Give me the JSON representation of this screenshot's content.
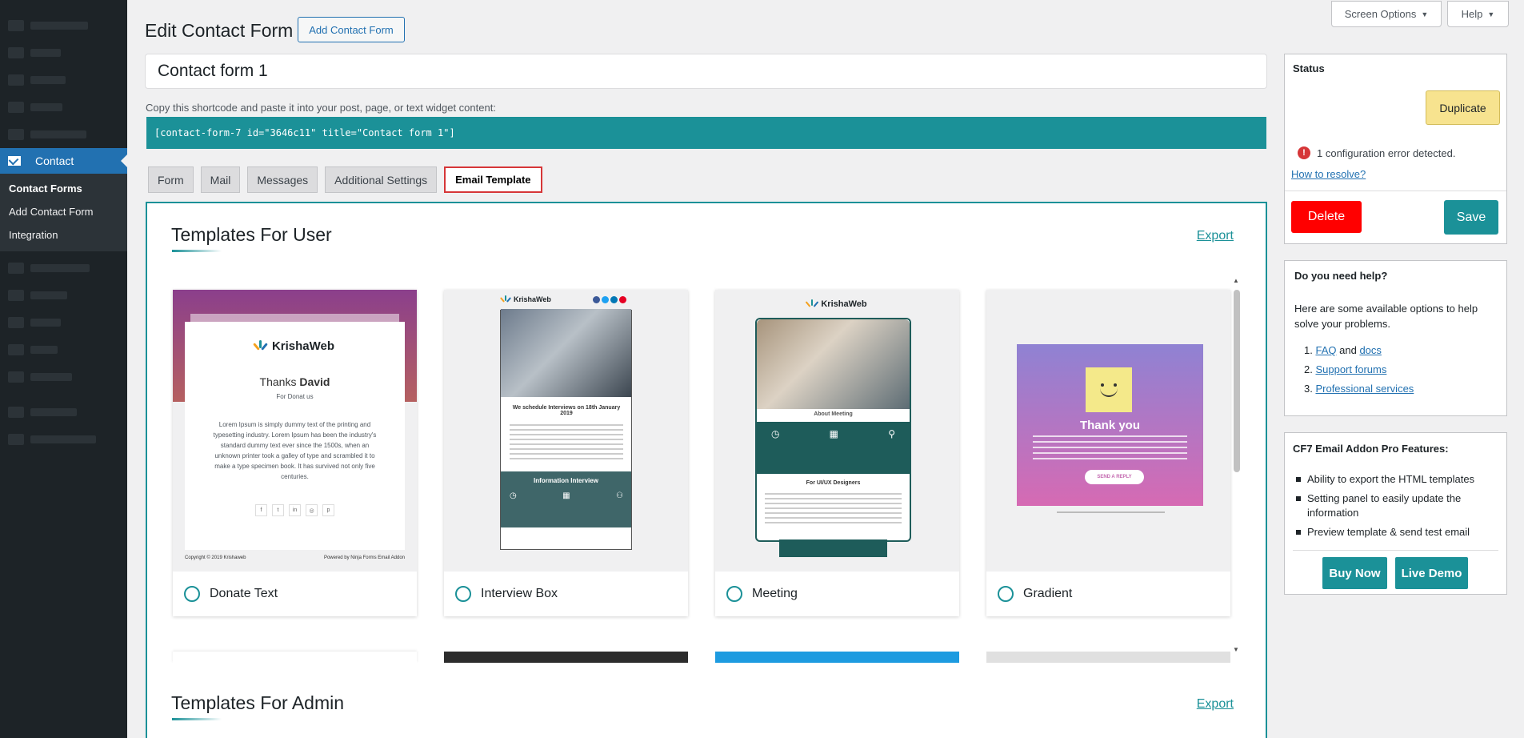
{
  "sidebar": {
    "current": "Contact",
    "submenu": [
      "Contact Forms",
      "Add Contact Form",
      "Integration"
    ]
  },
  "screen_options": "Screen Options",
  "help": "Help",
  "header": {
    "title": "Edit Contact Form",
    "add_button": "Add Contact Form"
  },
  "form_title": "Contact form 1",
  "shortcode": {
    "label": "Copy this shortcode and paste it into your post, page, or text widget content:",
    "code": "[contact-form-7 id=\"3646c11\" title=\"Contact form 1\"]"
  },
  "tabs": [
    "Form",
    "Mail",
    "Messages",
    "Additional Settings",
    "Email Template"
  ],
  "templates_user": {
    "title": "Templates For User",
    "export": "Export",
    "cards": [
      "Donate Text",
      "Interview Box",
      "Meeting",
      "Gradient"
    ]
  },
  "templates_admin": {
    "title": "Templates For Admin",
    "export": "Export"
  },
  "previews": {
    "logo": "KrishaWeb",
    "donate": {
      "thanks": "Thanks",
      "name": "David",
      "sub": "For Donat us",
      "body": "Lorem Ipsum is simply dummy text of the printing and typesetting industry. Lorem Ipsum has been the industry's standard dummy text ever since the 1500s, when an unknown printer took a galley of type and scrambled it to make a type specimen book. It has survived not only five centuries.",
      "copyright": "Copyright © 2019 Krishaweb",
      "powered": "Powered by Ninja Forms Email Addon"
    },
    "interview": {
      "heading": "We schedule Interviews on 18th January 2019",
      "box_title": "Information Interview"
    },
    "meeting": {
      "about": "About Meeting",
      "designers": "For UI/UX Designers"
    },
    "gradient": {
      "thanks": "Thank you",
      "button": "SEND A REPLY"
    }
  },
  "status_box": {
    "title": "Status",
    "duplicate": "Duplicate",
    "error": "1 configuration error detected.",
    "resolve_link": "How to resolve?",
    "delete": "Delete",
    "save": "Save"
  },
  "help_box": {
    "title": "Do you need help?",
    "intro": "Here are some available options to help solve your problems.",
    "item1_num": "1.",
    "faq": "FAQ",
    "and": "and",
    "docs": "docs",
    "item2_num": "2.",
    "support": "Support forums",
    "item3_num": "3.",
    "services": "Professional services"
  },
  "pro_box": {
    "title": "CF7 Email Addon Pro Features:",
    "features": [
      "Ability to export the HTML templates",
      "Setting panel to easily update the information",
      "Preview template & send test email"
    ],
    "buy": "Buy Now",
    "demo": "Live Demo"
  },
  "colors": {
    "accent": "#1b9198",
    "wp_blue": "#2271b1",
    "delete": "#ff0000",
    "duplicate": "#f7e38f"
  }
}
